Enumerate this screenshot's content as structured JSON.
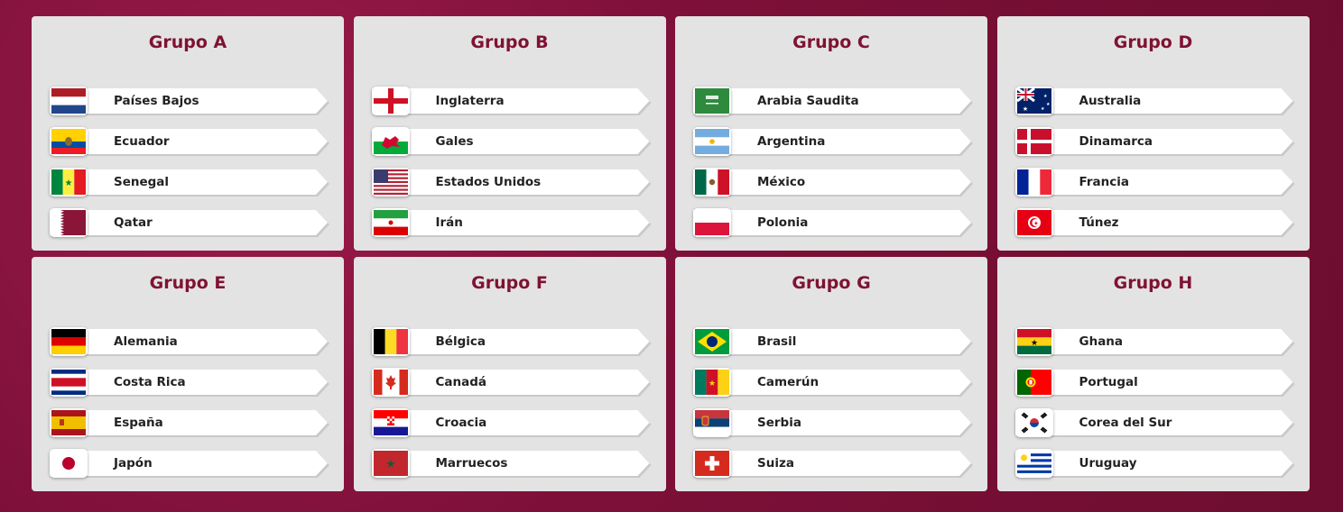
{
  "groups": [
    {
      "title": "Grupo A",
      "teams": [
        {
          "name": "Países Bajos",
          "flag": "netherlands-flag-icon"
        },
        {
          "name": "Ecuador",
          "flag": "ecuador-flag-icon"
        },
        {
          "name": "Senegal",
          "flag": "senegal-flag-icon"
        },
        {
          "name": "Qatar",
          "flag": "qatar-flag-icon"
        }
      ]
    },
    {
      "title": "Grupo B",
      "teams": [
        {
          "name": "Inglaterra",
          "flag": "england-flag-icon"
        },
        {
          "name": "Gales",
          "flag": "wales-flag-icon"
        },
        {
          "name": "Estados Unidos",
          "flag": "usa-flag-icon"
        },
        {
          "name": "Irán",
          "flag": "iran-flag-icon"
        }
      ]
    },
    {
      "title": "Grupo C",
      "teams": [
        {
          "name": "Arabia Saudita",
          "flag": "saudi-arabia-flag-icon"
        },
        {
          "name": "Argentina",
          "flag": "argentina-flag-icon"
        },
        {
          "name": "México",
          "flag": "mexico-flag-icon"
        },
        {
          "name": "Polonia",
          "flag": "poland-flag-icon"
        }
      ]
    },
    {
      "title": "Grupo D",
      "teams": [
        {
          "name": "Australia",
          "flag": "australia-flag-icon"
        },
        {
          "name": "Dinamarca",
          "flag": "denmark-flag-icon"
        },
        {
          "name": "Francia",
          "flag": "france-flag-icon"
        },
        {
          "name": "Túnez",
          "flag": "tunisia-flag-icon"
        }
      ]
    },
    {
      "title": "Grupo E",
      "teams": [
        {
          "name": "Alemania",
          "flag": "germany-flag-icon"
        },
        {
          "name": "Costa Rica",
          "flag": "costa-rica-flag-icon"
        },
        {
          "name": "España",
          "flag": "spain-flag-icon"
        },
        {
          "name": "Japón",
          "flag": "japan-flag-icon"
        }
      ]
    },
    {
      "title": "Grupo F",
      "teams": [
        {
          "name": "Bélgica",
          "flag": "belgium-flag-icon"
        },
        {
          "name": "Canadá",
          "flag": "canada-flag-icon"
        },
        {
          "name": "Croacia",
          "flag": "croatia-flag-icon"
        },
        {
          "name": "Marruecos",
          "flag": "morocco-flag-icon"
        }
      ]
    },
    {
      "title": "Grupo G",
      "teams": [
        {
          "name": "Brasil",
          "flag": "brazil-flag-icon"
        },
        {
          "name": "Camerún",
          "flag": "cameroon-flag-icon"
        },
        {
          "name": "Serbia",
          "flag": "serbia-flag-icon"
        },
        {
          "name": "Suiza",
          "flag": "switzerland-flag-icon"
        }
      ]
    },
    {
      "title": "Grupo H",
      "teams": [
        {
          "name": "Ghana",
          "flag": "ghana-flag-icon"
        },
        {
          "name": "Portugal",
          "flag": "portugal-flag-icon"
        },
        {
          "name": "Corea del Sur",
          "flag": "south-korea-flag-icon"
        },
        {
          "name": "Uruguay",
          "flag": "uruguay-flag-icon"
        }
      ]
    }
  ],
  "colors": {
    "background": "#7d1038",
    "title": "#7f1233",
    "panel": "#e3e3e3"
  }
}
